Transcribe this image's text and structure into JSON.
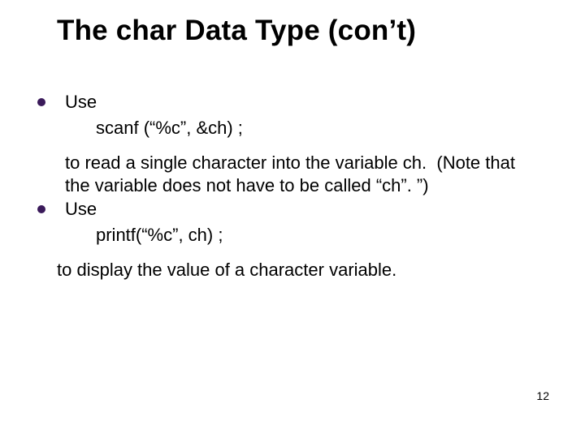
{
  "title": "The char Data Type (con’t)",
  "items": [
    {
      "label": "Use",
      "code": "scanf (“%c”, &ch) ;",
      "explain": "to read a single character into the variable ch.  (Note that the variable does not have to be called “ch”. ”)"
    },
    {
      "label": "Use",
      "code": "printf(“%c”, ch) ;",
      "explain": "to display the value of a character variable."
    }
  ],
  "page_number": "12"
}
